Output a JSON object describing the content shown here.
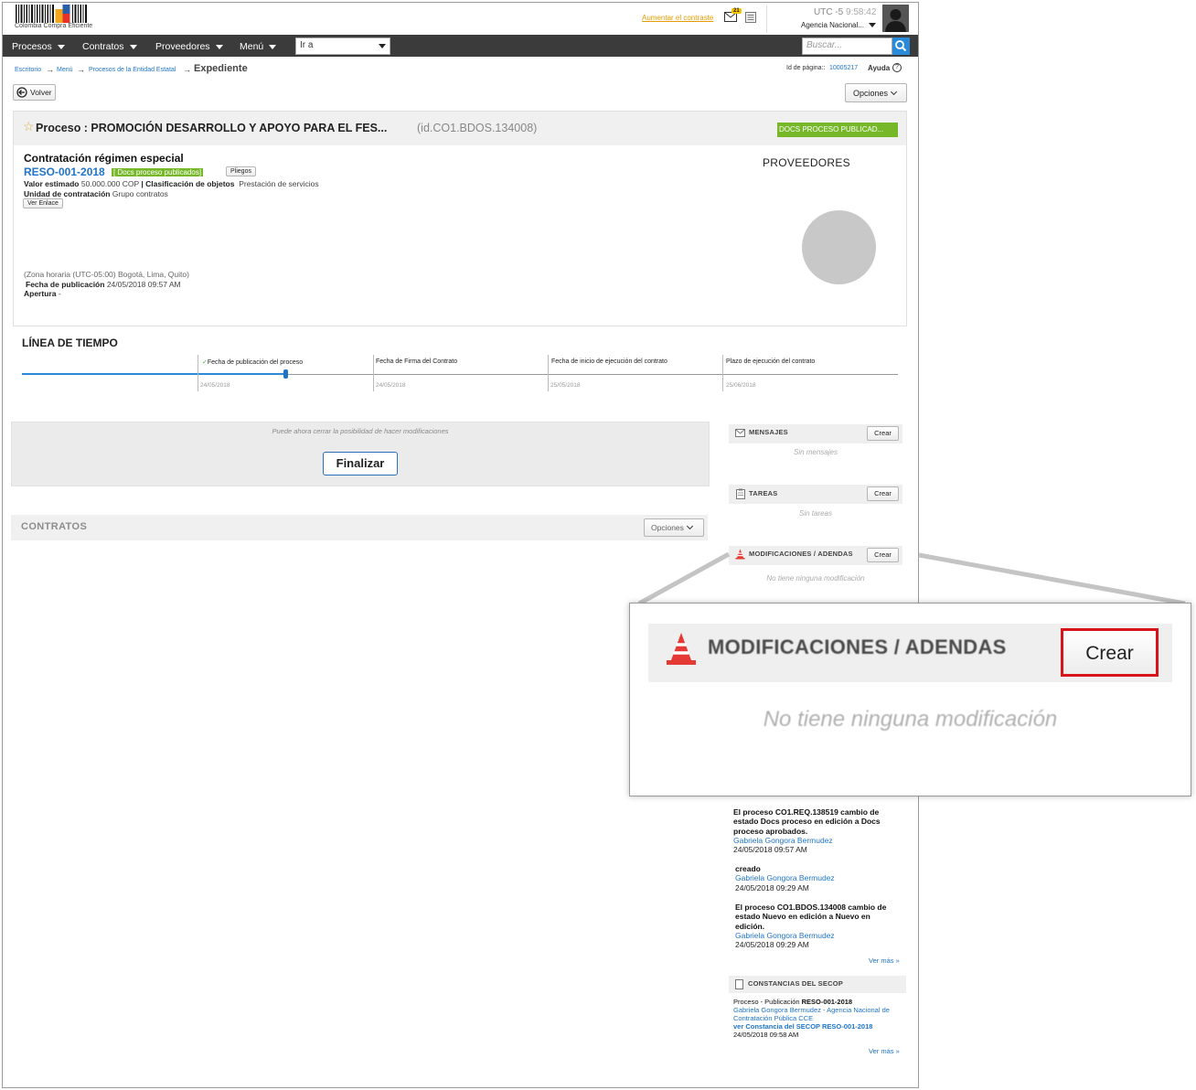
{
  "header": {
    "logo_caption": "Colombia Compra Eficiente",
    "contrast_link": "Aumentar el contraste",
    "mail_count": "21",
    "timezone": "UTC -5",
    "time": "9:58:42",
    "agency": "Agencia Nacional..."
  },
  "nav": {
    "items": [
      "Procesos",
      "Contratos",
      "Proveedores",
      "Menú"
    ],
    "goto_value": "Ir a",
    "search_placeholder": "Buscar..."
  },
  "breadcrumb": {
    "items": [
      "Escritorio",
      "Menú",
      "Procesos de la Entidad Estatal"
    ],
    "current": "Expediente",
    "page_id_label": "Id de página::",
    "page_id_value": "10005217",
    "help_label": "Ayuda"
  },
  "toolbar": {
    "back_label": "Volver",
    "options_label": "Opciones"
  },
  "process": {
    "title": "Proceso : PROMOCIÓN DESARROLLO Y APOYO PARA EL FES...",
    "id": "(id.CO1.BDOS.134008)",
    "status": "DOCS PROCESO PUBLICAD...",
    "modality": "Contratación régimen especial",
    "reference": "RESO-001-2018",
    "ref_badge": "[ Docs proceso publicados]",
    "pliegos_label": "Pliegos",
    "value_label": "Valor estimado",
    "value": "50.000.000 COP",
    "sep": "|",
    "class_label": "Clasificación de objetos",
    "class_value": "Prestación de servicios",
    "unit_label": "Unidad de contratación",
    "unit_value": "Grupo contratos",
    "ver_enlace": "Ver Enlace",
    "timezone": "(Zona horaria (UTC-05:00) Bogotá, Lima, Quito)",
    "pub_label": "Fecha de publicación",
    "pub_value": "24/05/2018 09:57 AM",
    "apertura_label": "Apertura",
    "apertura_value": "-",
    "providers_title": "PROVEEDORES"
  },
  "timeline": {
    "title": "LÍNEA DE TIEMPO",
    "check": "✓",
    "steps": [
      {
        "label": "Fecha de publicación del proceso",
        "date": "24/05/2018"
      },
      {
        "label": "Fecha de Firma del Contrato",
        "date": "24/05/2018"
      },
      {
        "label": "Fecha de inicio de ejecución del contrato",
        "date": "25/05/2018"
      },
      {
        "label": "Plazo de ejecución del contrato",
        "date": "25/06/2018"
      }
    ]
  },
  "finalize": {
    "hint": "Puede ahora cerrar la posibilidad de hacer modificaciones",
    "button": "Finalizar"
  },
  "contracts": {
    "title": "CONTRATOS",
    "options_label": "Opciones"
  },
  "side": {
    "crear_label": "Crear",
    "messages_title": "MENSAJES",
    "messages_empty": "Sin mensajes",
    "tasks_title": "TAREAS",
    "tasks_empty": "Sin tareas",
    "mods_title": "MODIFICACIONES / ADENDAS",
    "mods_empty": "No tiene ninguna modificación"
  },
  "zoom": {
    "title": "MODIFICACIONES / ADENDAS",
    "crear_label": "Crear",
    "empty": "No tiene ninguna modificación"
  },
  "feed": {
    "entries": [
      {
        "text": "El proceso CO1.REQ.138519 cambio de estado Docs proceso en edición a Docs proceso aprobados.",
        "author": "Gabriela Gongora Bermudez",
        "date": "24/05/2018 09:57 AM"
      },
      {
        "text": "creado",
        "author": "Gabriela Gongora Bermudez",
        "date": "24/05/2018 09:29 AM"
      },
      {
        "text": "El proceso CO1.BDOS.134008 cambio de estado Nuevo en edición a Nuevo en edición.",
        "author": "Gabriela Gongora Bermudez",
        "date": "24/05/2018 09:29 AM"
      }
    ],
    "ver_mas": "Ver más »"
  },
  "constancias": {
    "title": "CONSTANCIAS DEL SECOP",
    "line1_prefix": "Proceso - Publicación",
    "line1_ref": "RESO-001-2018",
    "author": "Gabriela Gongora Bermudez - Agencia Nacional de Contratación Pública CCE",
    "link": "ver Constancia del SECOP RESO-001-2018",
    "date": "24/05/2018 09:58 AM",
    "ver_mas": "Ver más »"
  },
  "colors": {
    "nav_bg": "#3b3b3b",
    "accent_blue": "#1f74c9",
    "status_green": "#76b82a",
    "highlight_red": "#d8141a"
  }
}
